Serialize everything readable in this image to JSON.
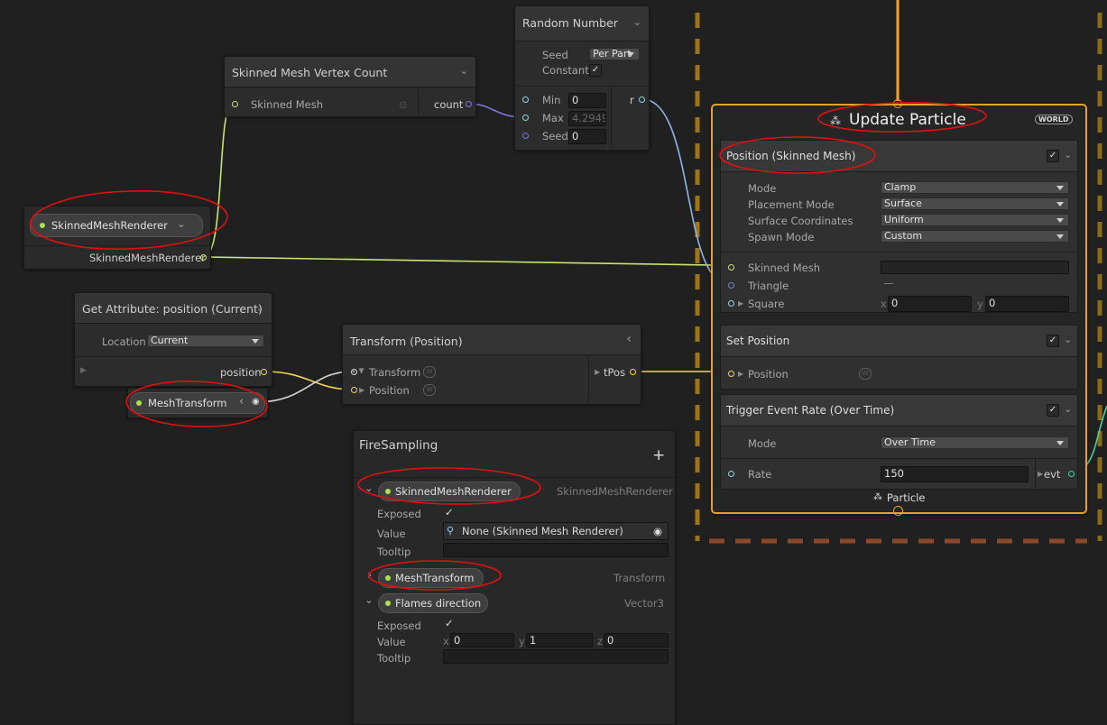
{
  "nodes": {
    "skinned_vertex_count": {
      "title": "Skinned Mesh Vertex Count",
      "input_label": "Skinned Mesh",
      "output_label": "count"
    },
    "random_number": {
      "title": "Random Number",
      "seed_label": "Seed",
      "seed_value": "Per Part",
      "constant_label": "Constant",
      "min_label": "Min",
      "min_value": "0",
      "max_label": "Max",
      "max_value": "4.2949",
      "seed2_label": "Seed",
      "seed2_value": "0",
      "output_label": "r"
    },
    "skinned_mesh_renderer_prop": {
      "pill_label": "SkinnedMeshRenderer",
      "output_label": "SkinnedMeshRenderer"
    },
    "get_attribute": {
      "title": "Get Attribute: position (Current)",
      "location_label": "Location",
      "location_value": "Current",
      "output_label": "position"
    },
    "mesh_transform_prop": {
      "pill_label": "MeshTransform"
    },
    "transform_position": {
      "title": "Transform (Position)",
      "input1": "Transform",
      "input2": "Position",
      "output_label": "tPos"
    }
  },
  "context": {
    "title": "Update Particle",
    "space_badge": "WORLD",
    "footer": "Particle",
    "blocks": [
      {
        "title": "Position (Skinned Mesh)",
        "settings": [
          {
            "label": "Mode",
            "value": "Clamp"
          },
          {
            "label": "Placement Mode",
            "value": "Surface"
          },
          {
            "label": "Surface Coordinates",
            "value": "Uniform"
          },
          {
            "label": "Spawn Mode",
            "value": "Custom"
          }
        ],
        "inputs": [
          {
            "label": "Skinned Mesh"
          },
          {
            "label": "Triangle"
          },
          {
            "label": "Square",
            "x": "0",
            "y": "0"
          }
        ]
      },
      {
        "title": "Set Position",
        "input": "Position"
      },
      {
        "title": "Trigger Event Rate (Over Time)",
        "mode_label": "Mode",
        "mode_value": "Over Time",
        "rate_label": "Rate",
        "rate_value": "150",
        "output": "evt"
      }
    ]
  },
  "blackboard": {
    "title": "FireSampling",
    "add_icon": "+",
    "props": [
      {
        "name": "SkinnedMeshRenderer",
        "type": "SkinnedMeshRenderer",
        "exposed_label": "Exposed",
        "value_label": "Value",
        "value": "None (Skinned Mesh Renderer)",
        "tooltip_label": "Tooltip"
      },
      {
        "name": "MeshTransform",
        "type": "Transform"
      },
      {
        "name": "Flames direction",
        "type": "Vector3",
        "exposed_label": "Exposed",
        "value_label": "Value",
        "x": "0",
        "y": "1",
        "z": "0",
        "tooltip_label": "Tooltip"
      }
    ]
  },
  "axis_labels": {
    "x": "x",
    "y": "y",
    "z": "z"
  },
  "icons": {
    "check": "✓",
    "chevron_down": "⌄",
    "chevron_left": "‹",
    "chevron_right": "›",
    "expand_down": "⌄",
    "triangle_right": "▶",
    "target": "◉",
    "object_field": "⊙"
  },
  "colors": {
    "context_border": "#e5a32a",
    "flow_wire": "#f5a623",
    "green_wire": "#c7e56e",
    "yellow_wire": "#f3d35a",
    "annotation": "#e01010",
    "dashed_frame": "#c08a1a"
  }
}
